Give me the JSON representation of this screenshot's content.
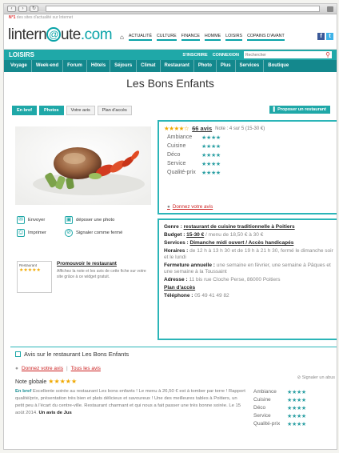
{
  "brand": {
    "tagline_prefix": "N°1",
    "tagline": "des sites d'actualité sur Internet",
    "logo_main": "lintern",
    "logo_at": "@",
    "logo_ute": "ute",
    "logo_tld": ".com"
  },
  "topnav": [
    "ACTUALITÉ",
    "CULTURE",
    "FINANCE",
    "HOMME",
    "LOISIRS",
    "COPAINS D'AVANT"
  ],
  "social": [
    "f",
    "t"
  ],
  "catbar": {
    "title": "LOISIRS",
    "signup": "S'INSCRIRE",
    "login": "CONNEXION",
    "search_placeholder": "Rechercher"
  },
  "subnav": [
    "Voyage",
    "Week-end",
    "Forum",
    "Hôtels",
    "Séjours",
    "Climat",
    "Restaurant",
    "Photo",
    "Plus",
    "Services",
    "Boutique"
  ],
  "page_title": "Les Bons Enfants",
  "tabs": [
    "En bref",
    "Photos",
    "Votre avis",
    "Plan d'accès"
  ],
  "propose_label": "Proposer un restaurant",
  "actions": {
    "send": "Envoyer",
    "post_photo": "déposer une photo",
    "print": "Imprimer",
    "report": "Signaler comme fermé"
  },
  "widget": {
    "mini_label": "Restaurant",
    "mini_stars": "★★★★★",
    "title": "Promouvoir le restaurant",
    "text": "Affichez la note et les avis de cette fiche sur votre site grâce à ce widget gratuit."
  },
  "rating": {
    "stars": "★★★★☆",
    "count": "66 avis",
    "note": "Note : 4 sur 5 (15-30 €)",
    "criteria": [
      {
        "label": "Ambiance",
        "stars": "★★★★"
      },
      {
        "label": "Cuisine",
        "stars": "★★★★"
      },
      {
        "label": "Déco",
        "stars": "★★★★"
      },
      {
        "label": "Service",
        "stars": "★★★★"
      },
      {
        "label": "Qualité-prix",
        "stars": "★★★★"
      }
    ],
    "give_opinion": "Donnez votre avis"
  },
  "info": {
    "genre_label": "Genre :",
    "genre_value": "restaurant de cuisine traditionnelle à Poitiers",
    "budget_label": "Budget :",
    "budget_value": "15-30 €",
    "budget_extra": "/ menu de 18,50 € à 30 €",
    "services_label": "Services :",
    "services_value": "Dimanche midi ouvert / Accès handicapés",
    "hours_label": "Horaires :",
    "hours_value": "de 12 h à 13 h 30 et de 19 h à 21 h 30, fermé le dimanche soir et le lundi",
    "closing_label": "Fermeture annuelle :",
    "closing_value": "une semaine en février, une semaine à Pâques et une semaine à la Toussaint",
    "address_label": "Adresse :",
    "address_value": "11 bis rue Cloche Perse, 86000 Poitiers",
    "map_label": "Plan d'accès",
    "phone_label": "Téléphone :",
    "phone_value": "05 49 41 49 82"
  },
  "reviews": {
    "title": "Avis sur le restaurant Les Bons Enfants",
    "give_opinion": "Donnez votre avis",
    "all_reviews": "Tous les avis",
    "report": "Signaler un abus",
    "global_label": "Note globale",
    "global_stars": "★★★★★",
    "en_bref": "En bref",
    "text": "Excellente soirée au restaurant Les bons enfants ! Le menu à 26,50 € est à tomber par terre ! Rapport qualité/prix, présentation très bien et plats délicieux et savoureux ! Une des meilleures tables à Poitiers, un petit peu à l'écart du centre-ville. Restaurant charmant et qui nous a fait passer une très bonne soirée. Le 15 août 2014.",
    "author": "Un avis de Jus",
    "criteria": [
      {
        "label": "Ambiance",
        "stars": "★★★★"
      },
      {
        "label": "Cuisine",
        "stars": "★★★★"
      },
      {
        "label": "Déco",
        "stars": "★★★★"
      },
      {
        "label": "Service",
        "stars": "★★★★"
      },
      {
        "label": "Qualité-prix",
        "stars": "★★★★"
      }
    ]
  }
}
